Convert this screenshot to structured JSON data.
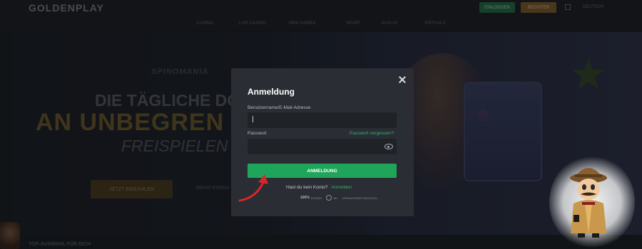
{
  "header": {
    "logo": "GOLDENPLAY",
    "login_button": "EINLOGGEN",
    "register_button": "REGISTER",
    "language": "DEUTSCH"
  },
  "nav": {
    "items": [
      "CASINO",
      "LIVE CASINO",
      "NEW GAMES",
      "SPORT",
      "IN-PLAY",
      "VIRTUALS"
    ]
  },
  "hero": {
    "subtitle": "SPINOMANIA",
    "line1": "DIE TÄGLICHE DO",
    "line2": "AN UNBEGREN",
    "line3": "FREISPIELEN",
    "join_button": "JETZT EINZAHLEN",
    "more_link": "MEHR ERFAH",
    "section_title": "TOP-AUSWAHL FÜR DICH"
  },
  "modal": {
    "title": "Anmeldung",
    "username_label": "Benutzername/E-Mail-Adresse",
    "username_value": "",
    "password_label": "Passwort",
    "password_value": "",
    "forgot_link": "Passwort vergessen?",
    "submit_button": "ANMELDUNG",
    "no_account_text": "Hast du kein Konto?",
    "register_link": "Anmelden",
    "trust_badges": [
      {
        "main": "100%",
        "sub": "SICHER"
      },
      {
        "main": "",
        "sub": "18+"
      },
      {
        "main": "",
        "sub": "VERANTWORTUNGSVOLL"
      }
    ]
  },
  "colors": {
    "accent_green": "#1fa559",
    "modal_bg": "#2a2d34",
    "input_bg": "#1f2227",
    "arrow_red": "#d7262b"
  }
}
